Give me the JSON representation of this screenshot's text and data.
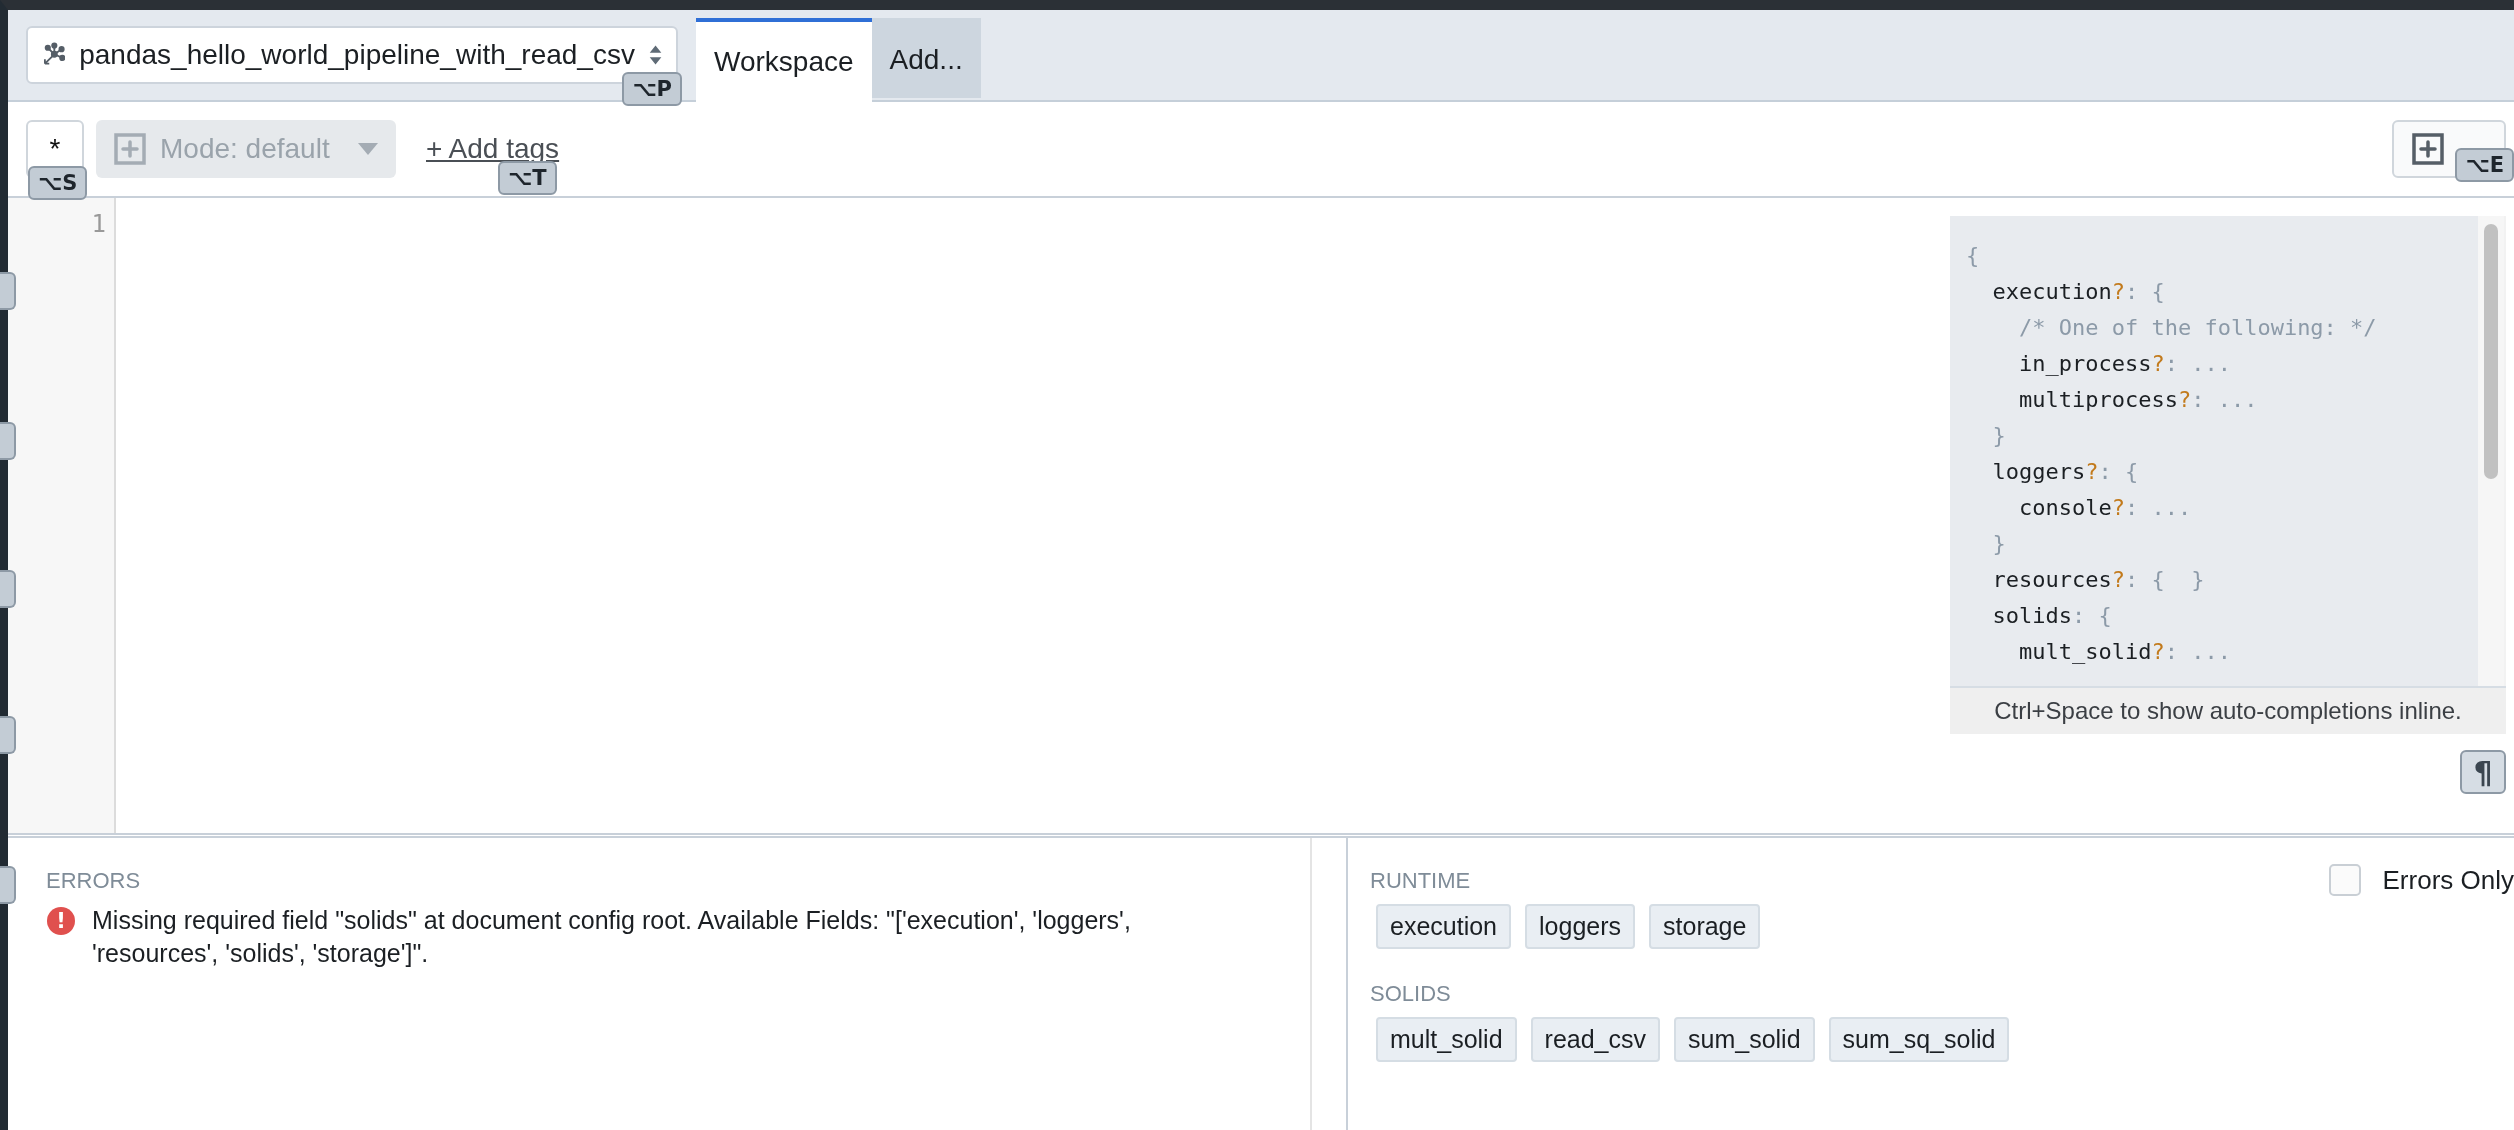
{
  "pipeline_selector": {
    "name": "pandas_hello_world_pipeline_with_read_csv",
    "shortcut": "⌥P"
  },
  "tabs": [
    {
      "label": "Workspace",
      "selected": true
    },
    {
      "label": "Add...",
      "selected": false
    }
  ],
  "toolbar": {
    "star_button": {
      "label": "*",
      "shortcut": "⌥S"
    },
    "mode_select": {
      "label": "Mode: default",
      "disabled": true
    },
    "add_tags": {
      "label": "+ Add tags",
      "shortcut": "⌥T"
    },
    "expand_button": {
      "shortcut": "⌥E"
    }
  },
  "editor": {
    "line_numbers": [
      "1"
    ],
    "schema_lines": [
      {
        "kind": "code",
        "text": "{"
      },
      {
        "kind": "code",
        "text": "  execution?: {"
      },
      {
        "kind": "comment",
        "text": "    /* One of the following: */"
      },
      {
        "kind": "code",
        "text": "    in_process?: ..."
      },
      {
        "kind": "code",
        "text": "    multiprocess?: ..."
      },
      {
        "kind": "code",
        "text": "  }"
      },
      {
        "kind": "code",
        "text": "  loggers?: {"
      },
      {
        "kind": "code",
        "text": "    console?: ..."
      },
      {
        "kind": "code",
        "text": "  }"
      },
      {
        "kind": "code",
        "text": "  resources?: {  }"
      },
      {
        "kind": "code",
        "text": "  solids: {"
      },
      {
        "kind": "code",
        "text": "    mult_solid?: ..."
      }
    ],
    "schema_hint": "Ctrl+Space to show auto-completions inline.",
    "whitespace_toggle": "¶"
  },
  "errors": {
    "title": "ERRORS",
    "items": [
      {
        "icon": "!",
        "message": "Missing required field \"solids\" at document config root. Available Fields: \"['execution', 'loggers', 'resources', 'solids', 'storage']\"."
      }
    ]
  },
  "config_sections": {
    "errors_only": {
      "label": "Errors Only",
      "checked": false
    },
    "groups": [
      {
        "title": "RUNTIME",
        "chips": [
          "execution",
          "loggers",
          "storage"
        ]
      },
      {
        "title": "SOLIDS",
        "chips": [
          "mult_solid",
          "read_csv",
          "sum_solid",
          "sum_sq_solid"
        ]
      }
    ]
  }
}
